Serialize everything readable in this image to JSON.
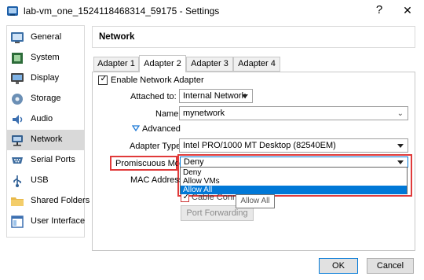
{
  "window": {
    "title": "lab-vm_one_1524118468314_59175 - Settings",
    "help_label": "?",
    "close_label": "✕"
  },
  "sidebar": {
    "items": [
      {
        "label": "General",
        "icon": "general-icon"
      },
      {
        "label": "System",
        "icon": "system-icon"
      },
      {
        "label": "Display",
        "icon": "display-icon"
      },
      {
        "label": "Storage",
        "icon": "storage-icon"
      },
      {
        "label": "Audio",
        "icon": "audio-icon"
      },
      {
        "label": "Network",
        "icon": "network-icon"
      },
      {
        "label": "Serial Ports",
        "icon": "serial-ports-icon"
      },
      {
        "label": "USB",
        "icon": "usb-icon"
      },
      {
        "label": "Shared Folders",
        "icon": "shared-folders-icon"
      },
      {
        "label": "User Interface",
        "icon": "user-interface-icon"
      }
    ]
  },
  "panel": {
    "title": "Network"
  },
  "tabs": [
    {
      "label": "Adapter 1"
    },
    {
      "label": "Adapter 2"
    },
    {
      "label": "Adapter 3"
    },
    {
      "label": "Adapter 4"
    }
  ],
  "adapter": {
    "enable_label": "Enable Network Adapter",
    "attached_to_label": "Attached to:",
    "attached_to_value": "Internal Network",
    "name_label": "Name:",
    "name_value": "mynetwork",
    "advanced_label": "Advanced",
    "adapter_type_label": "Adapter Type:",
    "adapter_type_value": "Intel PRO/1000 MT Desktop (82540EM)",
    "promiscuous_label": "Promiscuous Mode:",
    "promiscuous_value": "Deny",
    "promiscuous_options": [
      "Deny",
      "Allow VMs",
      "Allow All"
    ],
    "mac_label": "MAC Address:",
    "cable_label": "Cable Connected",
    "port_forwarding_label": "Port Forwarding",
    "tooltip": "Allow All"
  },
  "footer": {
    "ok_label": "OK",
    "cancel_label": "Cancel"
  },
  "colors": {
    "highlight": "#e03a3a",
    "selection": "#0078d7",
    "sidebar_active": "#d9d9d9"
  }
}
